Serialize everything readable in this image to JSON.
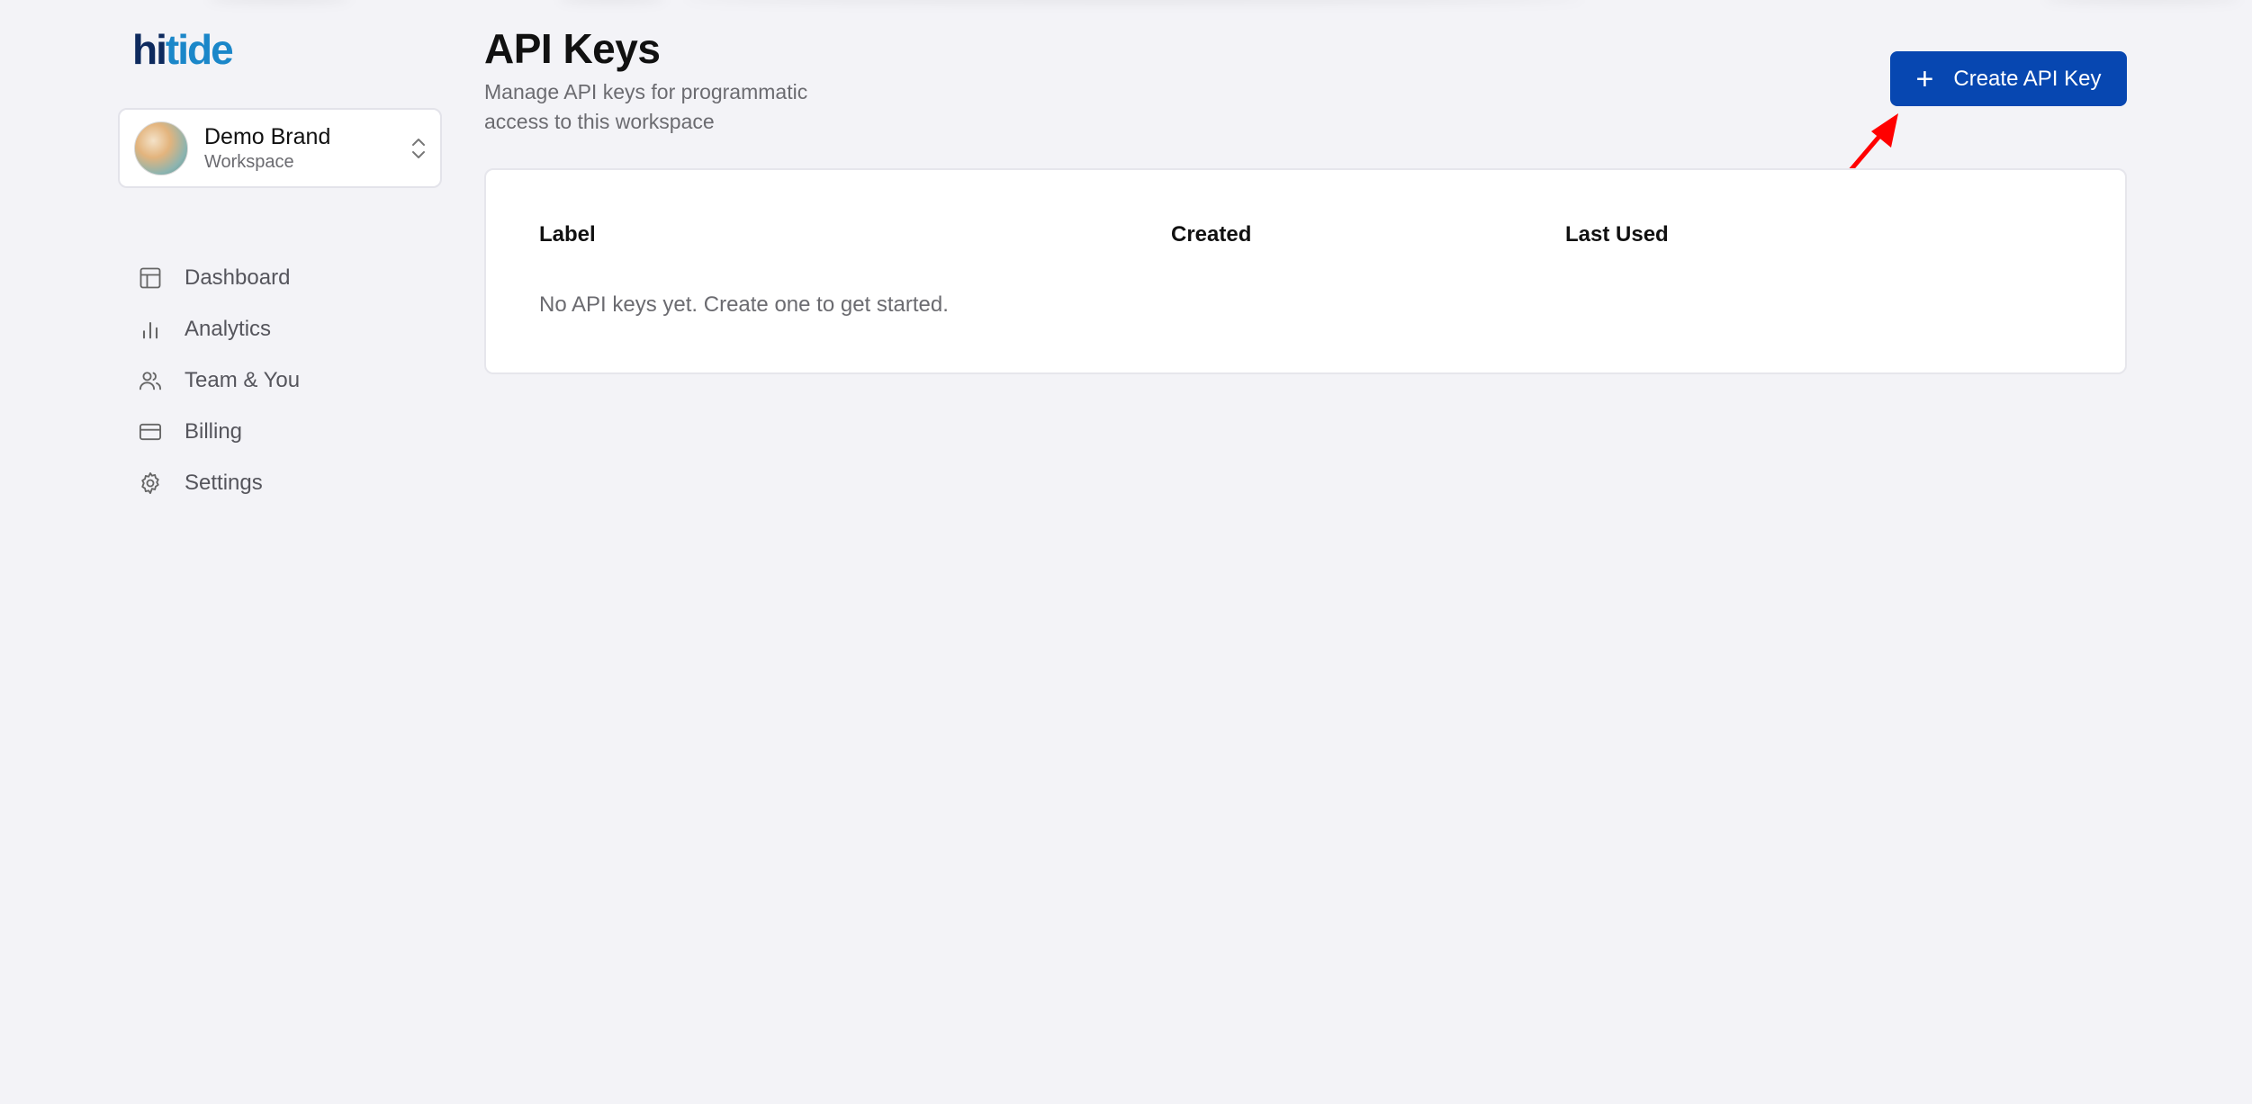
{
  "logo": {
    "part1": "hi",
    "part2": "tide"
  },
  "workspace": {
    "name": "Demo Brand",
    "subtitle": "Workspace"
  },
  "nav": [
    {
      "label": "Dashboard",
      "icon": "layout-icon"
    },
    {
      "label": "Analytics",
      "icon": "bar-chart-icon"
    },
    {
      "label": "Team & You",
      "icon": "users-icon"
    },
    {
      "label": "Billing",
      "icon": "credit-card-icon"
    },
    {
      "label": "Settings",
      "icon": "gear-icon"
    }
  ],
  "page": {
    "title": "API Keys",
    "subtitle": "Manage API keys for programmatic access to this workspace"
  },
  "create_button": {
    "label": "Create API Key",
    "icon": "plus-icon"
  },
  "table": {
    "columns": [
      "Label",
      "Created",
      "Last Used"
    ],
    "empty_text": "No API keys yet. Create one to get started."
  },
  "colors": {
    "background": "#f3f3f7",
    "primary": "#0747b1",
    "logo_dark": "#0e2a5e",
    "logo_light": "#1b87c9",
    "annotation_arrow": "#ff0000"
  }
}
